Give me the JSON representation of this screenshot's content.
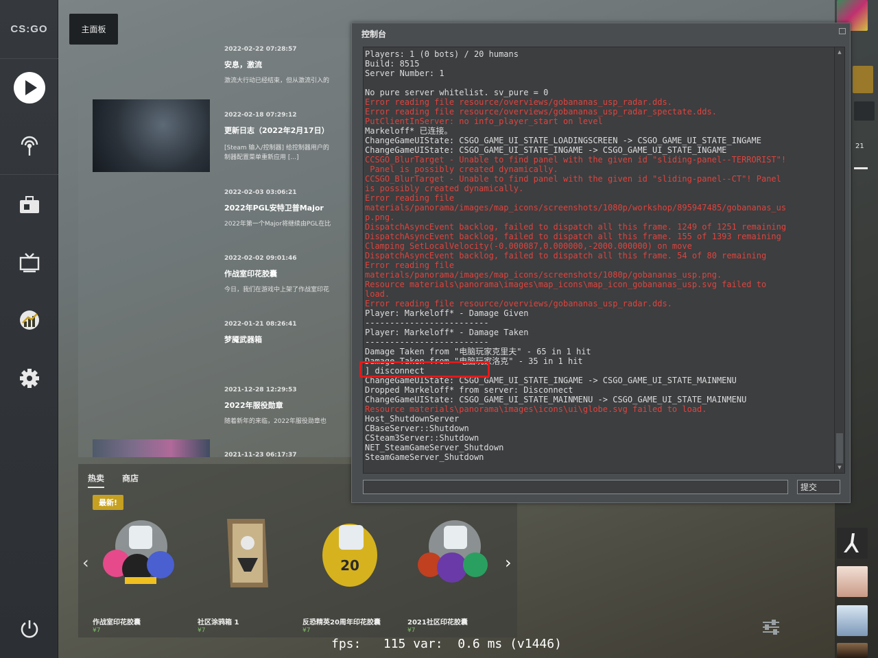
{
  "sidebar": {
    "logo": "CS:GO",
    "items": [
      {
        "name": "play",
        "icon": "play-icon"
      },
      {
        "name": "watch-broadcast",
        "icon": "antenna-icon"
      },
      {
        "name": "inventory",
        "icon": "briefcase-icon"
      },
      {
        "name": "watch",
        "icon": "tv-icon"
      },
      {
        "name": "stats",
        "icon": "chart-icon"
      },
      {
        "name": "settings",
        "icon": "gear-icon"
      },
      {
        "name": "quit",
        "icon": "power-icon"
      }
    ]
  },
  "main_tab": "主面板",
  "news": [
    {
      "date": "2022-02-22 07:28:57",
      "title": "安息，激流",
      "desc": "激流大行动已经结束，但从激流引入的"
    },
    {
      "date": "2022-02-18 07:29:12",
      "title": "更新日志（2022年2月17日）",
      "desc": "[Steam 输入/控制器] 给控制器用户的",
      "desc2": "制器配置菜单重新应用 [...]"
    },
    {
      "date": "2022-02-03 03:06:21",
      "title": "2022年PGL安特卫普Major",
      "desc": "2022年第一个Major将继续由PGL在比"
    },
    {
      "date": "2022-02-02 09:01:46",
      "title": "作战室印花胶囊",
      "desc": "今日，我们在游戏中上架了作战室印花"
    },
    {
      "date": "2022-01-21 08:26:41",
      "title": "梦魇武器箱",
      "desc": ""
    },
    {
      "date": "2021-12-28 12:29:53",
      "title": "2022年服役勋章",
      "desc": "随着新年的来临，2022年服役勋章也"
    },
    {
      "date": "2021-11-23 06:17:37",
      "title": "",
      "desc": ""
    }
  ],
  "store": {
    "tabs": [
      "热卖",
      "商店"
    ],
    "badge": "最新!",
    "items": [
      {
        "name": "作战室印花胶囊",
        "price": "¥7"
      },
      {
        "name": "社区涂鸦箱 1",
        "price": "¥7"
      },
      {
        "name": "反恐精英20周年印花胶囊",
        "price": "¥7"
      },
      {
        "name": "2021社区印花胶囊",
        "price": "¥7"
      }
    ]
  },
  "friends_bar": {
    "count": "21"
  },
  "console": {
    "title": "控制台",
    "submit_label": "提交",
    "input_value": "",
    "lines": [
      {
        "t": "Players: 1 (0 bots) / 20 humans",
        "err": false
      },
      {
        "t": "Build: 8515",
        "err": false
      },
      {
        "t": "Server Number: 1",
        "err": false
      },
      {
        "t": "",
        "err": false
      },
      {
        "t": "No pure server whitelist. sv_pure = 0",
        "err": false
      },
      {
        "t": "Error reading file resource/overviews/gobananas_usp_radar.dds.",
        "err": true
      },
      {
        "t": "Error reading file resource/overviews/gobananas_usp_radar_spectate.dds.",
        "err": true
      },
      {
        "t": "PutClientInServer: no info_player_start on level",
        "err": true
      },
      {
        "t": "Markeloff* 已连接。",
        "err": false
      },
      {
        "t": "ChangeGameUIState: CSGO_GAME_UI_STATE_LOADINGSCREEN -> CSGO_GAME_UI_STATE_INGAME",
        "err": false
      },
      {
        "t": "ChangeGameUIState: CSGO_GAME_UI_STATE_INGAME -> CSGO_GAME_UI_STATE_INGAME",
        "err": false
      },
      {
        "t": "CCSGO_BlurTarget - Unable to find panel with the given id \"sliding-panel--TERRORIST\"!",
        "err": true
      },
      {
        "t": " Panel is possibly created dynamically.",
        "err": true
      },
      {
        "t": "CCSGO_BlurTarget - Unable to find panel with the given id \"sliding-panel--CT\"! Panel",
        "err": true
      },
      {
        "t": "is possibly created dynamically.",
        "err": true
      },
      {
        "t": "Error reading file",
        "err": true
      },
      {
        "t": "materials/panorama/images/map_icons/screenshots/1080p/workshop/895947485/gobananas_us",
        "err": true
      },
      {
        "t": "p.png.",
        "err": true
      },
      {
        "t": "DispatchAsyncEvent backlog, failed to dispatch all this frame. 1249 of 1251 remaining",
        "err": true
      },
      {
        "t": "DispatchAsyncEvent backlog, failed to dispatch all this frame. 155 of 1393 remaining",
        "err": true
      },
      {
        "t": "Clamping SetLocalVelocity(-0.000087,0.000000,-2000.000000) on move",
        "err": true
      },
      {
        "t": "DispatchAsyncEvent backlog, failed to dispatch all this frame. 54 of 80 remaining",
        "err": true
      },
      {
        "t": "Error reading file",
        "err": true
      },
      {
        "t": "materials/panorama/images/map_icons/screenshots/1080p/gobananas_usp.png.",
        "err": true
      },
      {
        "t": "Resource materials\\panorama\\images\\map_icons\\map_icon_gobananas_usp.svg failed to",
        "err": true
      },
      {
        "t": "load.",
        "err": true
      },
      {
        "t": "Error reading file resource/overviews/gobananas_usp_radar.dds.",
        "err": true
      },
      {
        "t": "Player: Markeloff* - Damage Given",
        "err": false
      },
      {
        "t": "-------------------------",
        "err": false
      },
      {
        "t": "Player: Markeloff* - Damage Taken",
        "err": false
      },
      {
        "t": "-------------------------",
        "err": false
      },
      {
        "t": "Damage Taken from \"电脑玩家克里夫\" - 65 in 1 hit",
        "err": false
      },
      {
        "t": "Damage Taken from \"电脑玩家洛克\" - 35 in 1 hit",
        "err": false
      },
      {
        "t": "] disconnect",
        "err": false
      },
      {
        "t": "ChangeGameUIState: CSGO_GAME_UI_STATE_INGAME -> CSGO_GAME_UI_STATE_MAINMENU",
        "err": false
      },
      {
        "t": "Dropped Markeloff* from server: Disconnect",
        "err": false
      },
      {
        "t": "ChangeGameUIState: CSGO_GAME_UI_STATE_MAINMENU -> CSGO_GAME_UI_STATE_MAINMENU",
        "err": false
      },
      {
        "t": "Resource materials\\panorama\\images\\icons\\ui\\globe.svg failed to load.",
        "err": true
      },
      {
        "t": "Host_ShutdownServer",
        "err": false
      },
      {
        "t": "CBaseServer::Shutdown",
        "err": false
      },
      {
        "t": "CSteam3Server::Shutdown",
        "err": false
      },
      {
        "t": "NET_SteamGameServer_Shutdown",
        "err": false
      },
      {
        "t": "SteamGameServer_Shutdown",
        "err": false
      }
    ]
  },
  "fps_readout": "fps:   115 var:  0.6 ms (v1446)",
  "colors": {
    "error_text": "#e0433d",
    "highlight": "#e01b1b",
    "badge": "#c5a021"
  }
}
